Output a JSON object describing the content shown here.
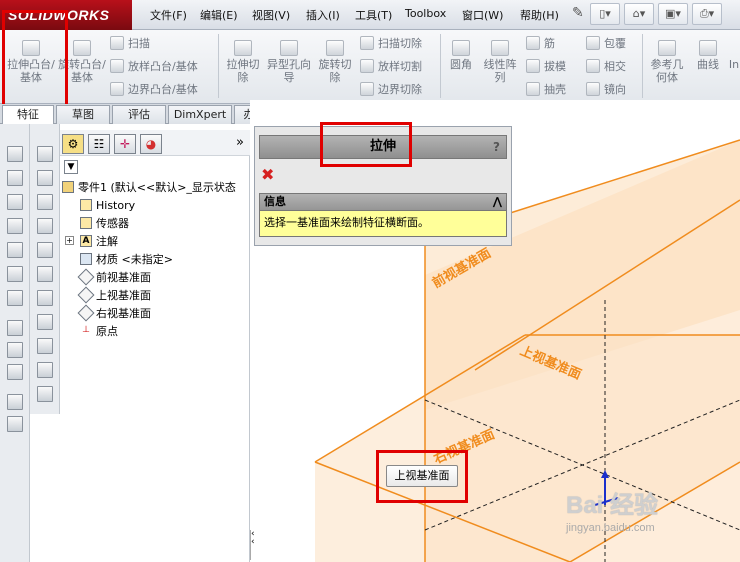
{
  "app": {
    "logo_text": "SOLIDWORKS"
  },
  "menu": [
    "文件(F)",
    "编辑(E)",
    "视图(V)",
    "插入(I)",
    "工具(T)",
    "Toolbox",
    "窗口(W)",
    "帮助(H)"
  ],
  "ribbon": {
    "extrude_boss": "拉伸凸台/基体",
    "revolve_boss": "旋转凸台/基体",
    "sweep": "扫描",
    "loft_boss": "放样凸台/基体",
    "boundary_boss": "边界凸台/基体",
    "extrude_cut": "拉伸切除",
    "hole_wizard": "异型孔向导",
    "revolve_cut": "旋转切除",
    "sweep_cut": "扫描切除",
    "loft_cut": "放样切割",
    "boundary_cut": "边界切除",
    "fillet": "圆角",
    "linear_pattern": "线性阵列",
    "rib": "筋",
    "draft": "拔模",
    "shell": "抽壳",
    "wrap": "包覆",
    "intersect": "相交",
    "mirror": "镜向",
    "ref_geometry": "参考几何体",
    "curves": "曲线",
    "instant3d": "In"
  },
  "tabs": [
    "特征",
    "草图",
    "评估",
    "DimXpert",
    "办公室产品"
  ],
  "tree": {
    "root": "零件1  (默认<<默认>_显示状态",
    "items": [
      "History",
      "传感器",
      "注解",
      "材质 <未指定>",
      "前视基准面",
      "上视基准面",
      "右视基准面",
      "原点"
    ],
    "expand_arrow": "»"
  },
  "property_manager": {
    "title": "拉伸",
    "help": "?",
    "info_title": "信息",
    "info_text": "选择一基准面来绘制特征横断面。",
    "collapse": "⋀"
  },
  "viewport": {
    "plane_front": "前视基准面",
    "plane_top": "上视基准面",
    "plane_right": "右视基准面",
    "tooltip": "上视基准面",
    "watermark_main": "Bai 经验",
    "watermark_url": "jingyan.baidu.com",
    "plane_color": "#f08c1e",
    "plane_fill": "#fbe3c8"
  }
}
